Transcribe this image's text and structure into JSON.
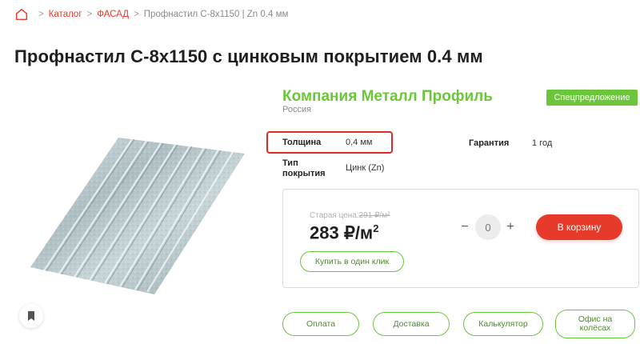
{
  "breadcrumb": {
    "home_icon": "home-icon",
    "items": [
      {
        "label": "Каталог"
      },
      {
        "label": "ФАСАД"
      },
      {
        "label": "Профнастил С-8х1150 | Zn 0.4 мм"
      }
    ],
    "separator": ">"
  },
  "product": {
    "title": "Профнастил С-8х1150 с цинковым покрытием 0.4 мм",
    "company": "Компания Металл Профиль",
    "country": "Россия",
    "promo_badge": "Спецпредложение"
  },
  "specs": {
    "thickness_label": "Толщина",
    "thickness_value": "0,4 мм",
    "warranty_label": "Гарантия",
    "warranty_value": "1 год",
    "coating_label_1": "Тип",
    "coating_label_2": "покрытия",
    "coating_value": "Цинк (Zn)"
  },
  "pricing": {
    "old_price_label": "Старая цена:",
    "old_price_value": "291 ₽/м²",
    "price": "283 ₽/м",
    "price_unit_sup": "2"
  },
  "cart": {
    "minus": "−",
    "quantity": "0",
    "plus": "+",
    "add_to_cart": "В корзину",
    "one_click": "Купить в один клик"
  },
  "actions": {
    "payment": "Оплата",
    "delivery": "Доставка",
    "calculator": "Калькулятор",
    "office_1": "Офис на",
    "office_2": "колёсах"
  },
  "colors": {
    "accent_red": "#e63a2a",
    "accent_green": "#6cc63c",
    "highlight_border": "#e02929"
  }
}
